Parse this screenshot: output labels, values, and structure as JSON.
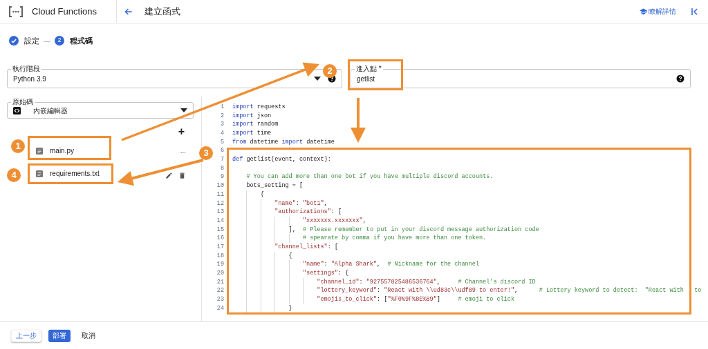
{
  "header": {
    "product": "Cloud Functions",
    "title": "建立函式",
    "learn_more": "瞭解詳情"
  },
  "stepper": [
    {
      "label": "設定",
      "done": true,
      "selected": false
    },
    {
      "label": "程式碼",
      "number": "2",
      "done": false,
      "selected": true
    }
  ],
  "stepper_separator": "—",
  "runtime": {
    "label": "執行階段",
    "value": "Python 3.9"
  },
  "entry_point": {
    "label": "進入點 *",
    "value": "getlist"
  },
  "source": {
    "label": "原始碼",
    "value": "內嵌編輯器"
  },
  "add_file": "+",
  "files": [
    {
      "name": "main.py",
      "more": "..."
    },
    {
      "name": "requirements.txt"
    }
  ],
  "code_lines": [
    {
      "number": "1",
      "segments": [
        {
          "kind": "keyword",
          "text": "import"
        },
        {
          "kind": "plain",
          "text": " requests"
        }
      ]
    },
    {
      "number": "2",
      "segments": [
        {
          "kind": "keyword",
          "text": "import"
        },
        {
          "kind": "plain",
          "text": " json"
        }
      ]
    },
    {
      "number": "3",
      "segments": [
        {
          "kind": "keyword",
          "text": "import"
        },
        {
          "kind": "plain",
          "text": " random"
        }
      ]
    },
    {
      "number": "4",
      "segments": [
        {
          "kind": "keyword",
          "text": "import"
        },
        {
          "kind": "plain",
          "text": " time"
        }
      ]
    },
    {
      "number": "5",
      "segments": [
        {
          "kind": "keyword",
          "text": "from"
        },
        {
          "kind": "plain",
          "text": " datetime "
        },
        {
          "kind": "keyword",
          "text": "import"
        },
        {
          "kind": "plain",
          "text": " datetime"
        }
      ]
    },
    {
      "number": "6"
    },
    {
      "number": "7",
      "segments": [
        {
          "kind": "keyword",
          "text": "def"
        },
        {
          "kind": "plain",
          "text": " getlist(event, context):"
        }
      ]
    },
    {
      "number": "8"
    },
    {
      "number": "9",
      "segments": [
        {
          "kind": "comment",
          "text": "    # You can add more than one bot if you have multiple discord accounts."
        }
      ]
    },
    {
      "number": "10",
      "segments": [
        {
          "kind": "plain",
          "text": "    bots_setting = ["
        }
      ]
    },
    {
      "number": "11",
      "segments": [
        {
          "kind": "plain",
          "text": "        {"
        }
      ]
    },
    {
      "number": "12",
      "segments": [
        {
          "kind": "string",
          "text": "            \"name\""
        },
        {
          "kind": "plain",
          "text": ": "
        },
        {
          "kind": "string",
          "text": "\"bot1\""
        },
        {
          "kind": "plain",
          "text": ","
        }
      ]
    },
    {
      "number": "13",
      "segments": [
        {
          "kind": "string",
          "text": "            \"authorizations\""
        },
        {
          "kind": "plain",
          "text": ": ["
        }
      ]
    },
    {
      "number": "14",
      "segments": [
        {
          "kind": "string",
          "text": "                    \"xxxxxxx.xxxxxxx\""
        },
        {
          "kind": "plain",
          "text": ","
        }
      ]
    },
    {
      "number": "15",
      "segments": [
        {
          "kind": "plain",
          "text": "                ],  "
        },
        {
          "kind": "comment",
          "text": "# Please remember to put in your discord message authorization code"
        }
      ]
    },
    {
      "number": "16",
      "segments": [
        {
          "kind": "comment",
          "text": "                    # spearate by comma if you have more than one token."
        }
      ]
    },
    {
      "number": "17",
      "segments": [
        {
          "kind": "string",
          "text": "            \"channel_lists\""
        },
        {
          "kind": "plain",
          "text": ": ["
        }
      ]
    },
    {
      "number": "18",
      "segments": [
        {
          "kind": "plain",
          "text": "                {"
        }
      ]
    },
    {
      "number": "19",
      "segments": [
        {
          "kind": "string",
          "text": "                    \"name\""
        },
        {
          "kind": "plain",
          "text": ": "
        },
        {
          "kind": "string",
          "text": "\"Alpha Shark\""
        },
        {
          "kind": "plain",
          "text": ",  "
        },
        {
          "kind": "comment",
          "text": "# Nickname for the channel"
        }
      ]
    },
    {
      "number": "20",
      "segments": [
        {
          "kind": "string",
          "text": "                    \"settings\""
        },
        {
          "kind": "plain",
          "text": ": {"
        }
      ]
    },
    {
      "number": "21",
      "segments": [
        {
          "kind": "string",
          "text": "                        \"channel_id\""
        },
        {
          "kind": "plain",
          "text": ": "
        },
        {
          "kind": "string",
          "text": "\"927557825486536764\""
        },
        {
          "kind": "plain",
          "text": ",     "
        },
        {
          "kind": "comment",
          "text": "# Channel's discord ID"
        }
      ]
    },
    {
      "number": "22",
      "segments": [
        {
          "kind": "string",
          "text": "                        \"lottery_keyword\""
        },
        {
          "kind": "plain",
          "text": ": "
        },
        {
          "kind": "string",
          "text": "\"React with \\\\ud83c\\\\udf89 to enter!\""
        },
        {
          "kind": "plain",
          "text": ",      "
        },
        {
          "kind": "comment",
          "text": "# Lottery keyword to detect:  \"React with   to"
        }
      ]
    },
    {
      "number": "23",
      "segments": [
        {
          "kind": "string",
          "text": "                        \"emojis_to_click\""
        },
        {
          "kind": "plain",
          "text": ": ["
        },
        {
          "kind": "string",
          "text": "\"%F0%9F%8E%89\""
        },
        {
          "kind": "plain",
          "text": "]     "
        },
        {
          "kind": "comment",
          "text": "# emoji to click"
        }
      ]
    },
    {
      "number": "24",
      "segments": [
        {
          "kind": "plain",
          "text": "                }"
        }
      ]
    }
  ],
  "footer": {
    "buttons": [
      {
        "label": "上一步",
        "kind": "outlined"
      },
      {
        "label": "部署",
        "kind": "primary"
      },
      {
        "label": "取消",
        "kind": "text"
      }
    ]
  },
  "annotations": [
    {
      "label": "1"
    },
    {
      "label": "2"
    },
    {
      "label": "3"
    },
    {
      "label": "4"
    }
  ]
}
